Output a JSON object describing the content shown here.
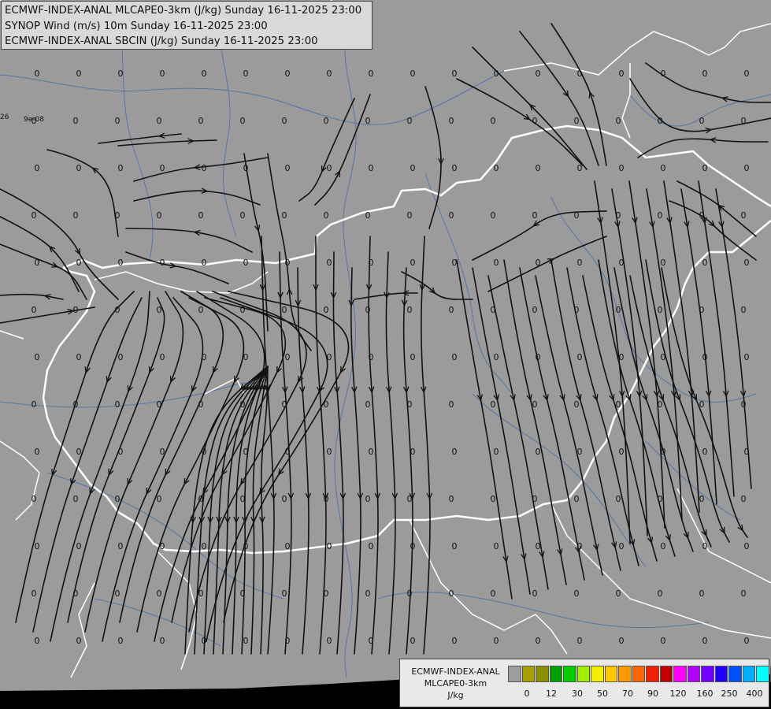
{
  "titles": [
    "ECMWF-INDEX-ANAL MLCAPE0-3km (J/kg) Sunday 16-11-2025 23:00",
    "SYNOP Wind (m/s) 10m Sunday 16-11-2025 23:00",
    "ECMWF-INDEX-ANAL SBCIN (J/kg) Sunday 16-11-2025 23:00"
  ],
  "map": {
    "background": "#9b9b9b",
    "border_color": "#ffffff",
    "river_color": "#4a6fa5",
    "streamline_color": "#111111",
    "value_labels": [
      "0",
      "9e-08",
      "26"
    ]
  },
  "legend": {
    "line1": "ECMWF-INDEX-ANAL",
    "line2": "MLCAPE0-3km",
    "line3": "J/kg",
    "colors": [
      "#9e9e9e",
      "#a8a000",
      "#8e8e00",
      "#00a000",
      "#00cc00",
      "#a0f000",
      "#f0f000",
      "#ffc800",
      "#ff9900",
      "#ff6600",
      "#f02000",
      "#c00000",
      "#ff00ff",
      "#b000ff",
      "#7000ff",
      "#2000ff",
      "#0050ff",
      "#00b0ff",
      "#00ffff",
      "#a0ffff",
      "#ffffff"
    ],
    "ticks": [
      "0",
      "12",
      "30",
      "50",
      "70",
      "90",
      "120",
      "160",
      "250",
      "400"
    ]
  }
}
